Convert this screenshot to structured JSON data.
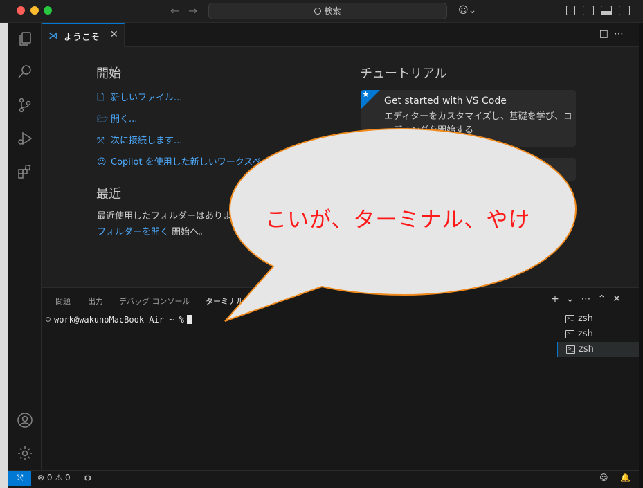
{
  "titlebar": {
    "search_label": "検索"
  },
  "tab": {
    "title": "ようこそ"
  },
  "welcome": {
    "start_heading": "開始",
    "start_links": [
      {
        "icon": "new-file-icon",
        "label": "新しいファイル..."
      },
      {
        "icon": "open-folder-icon",
        "label": "開く..."
      },
      {
        "icon": "remote-connect-icon",
        "label": "次に接続します..."
      },
      {
        "icon": "copilot-icon",
        "label": "Copilot を使用した新しいワークスペース..."
      }
    ],
    "recent_heading": "最近",
    "recent_empty": "最近使用したフォルダーはありません",
    "open_folder_link": "フォルダーを開く",
    "open_folder_suffix": " 開始へ。",
    "tutorial_heading": "チュートリアル",
    "tutorial_card": {
      "title": "Get started with VS Code",
      "description": "エディターをカスタマイズし、基礎を学び、コーディングを開始する"
    }
  },
  "panel": {
    "tabs": [
      "問題",
      "出力",
      "デバッグ コンソール",
      "ターミナル"
    ],
    "active_tab": "ターミナル",
    "prompt": "work@wakunoMacBook-Air ~ %",
    "terminals": [
      "zsh",
      "zsh",
      "zsh"
    ]
  },
  "statusbar": {
    "errors": "0",
    "warnings": "0"
  },
  "annotation": {
    "bubble_text": "こいが、ターミナル、やけ",
    "bubble_fill": "#e6e6e6",
    "bubble_stroke": "#f08a1c",
    "text_color": "#ff1a1a"
  },
  "colors": {
    "accent": "#0078d4",
    "link": "#4daafc"
  }
}
